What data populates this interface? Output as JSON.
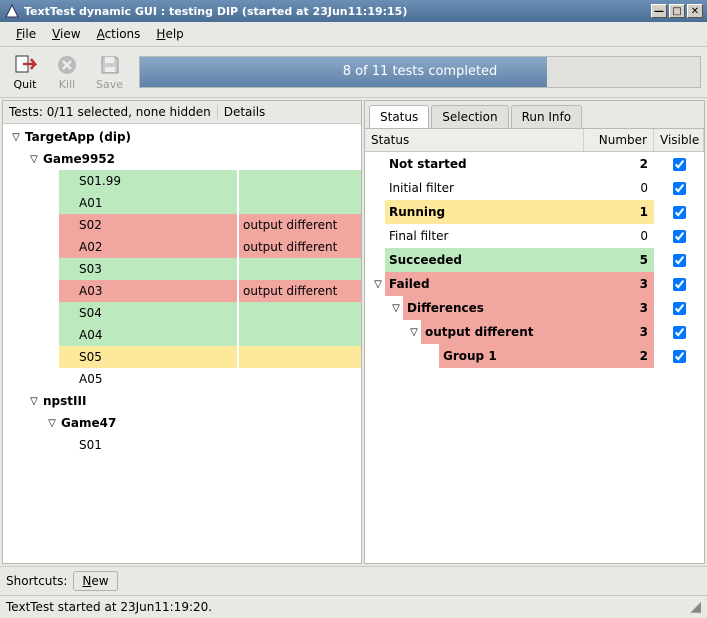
{
  "window": {
    "title": "TextTest dynamic GUI : testing DIP (started at 23Jun11:19:15)"
  },
  "menubar": {
    "file": "File",
    "view": "View",
    "actions": "Actions",
    "help": "Help"
  },
  "toolbar": {
    "quit": "Quit",
    "kill": "Kill",
    "save": "Save"
  },
  "progress": {
    "text": "8 of 11 tests completed"
  },
  "left": {
    "summary": "Tests: 0/11 selected, none hidden",
    "details": "Details",
    "root": "TargetApp (dip)",
    "suite1": "Game9952",
    "tests": [
      {
        "name": "S01.99",
        "detail": "",
        "color": "green"
      },
      {
        "name": "A01",
        "detail": "",
        "color": "green"
      },
      {
        "name": "S02",
        "detail": "output different",
        "color": "red"
      },
      {
        "name": "A02",
        "detail": "output different",
        "color": "red"
      },
      {
        "name": "S03",
        "detail": "",
        "color": "green"
      },
      {
        "name": "A03",
        "detail": "output different",
        "color": "red"
      },
      {
        "name": "S04",
        "detail": "",
        "color": "green"
      },
      {
        "name": "A04",
        "detail": "",
        "color": "green"
      },
      {
        "name": "S05",
        "detail": "",
        "color": "yellow"
      },
      {
        "name": "A05",
        "detail": "",
        "color": "none"
      }
    ],
    "suite2": "npstIII",
    "suite2_game": "Game47",
    "suite2_test": "S01"
  },
  "tabs": {
    "status": "Status",
    "selection": "Selection",
    "runinfo": "Run Info"
  },
  "status_header": {
    "status": "Status",
    "number": "Number",
    "visible": "Visible"
  },
  "status_rows": [
    {
      "indent": 0,
      "exp": "",
      "label": "Not started",
      "num": "2",
      "bold": true,
      "color": "none"
    },
    {
      "indent": 0,
      "exp": "",
      "label": "Initial filter",
      "num": "0",
      "bold": false,
      "color": "none"
    },
    {
      "indent": 0,
      "exp": "",
      "label": "Running",
      "num": "1",
      "bold": true,
      "color": "yellow"
    },
    {
      "indent": 0,
      "exp": "",
      "label": "Final filter",
      "num": "0",
      "bold": false,
      "color": "none"
    },
    {
      "indent": 0,
      "exp": "",
      "label": "Succeeded",
      "num": "5",
      "bold": true,
      "color": "green"
    },
    {
      "indent": 0,
      "exp": "▽",
      "label": "Failed",
      "num": "3",
      "bold": true,
      "color": "red"
    },
    {
      "indent": 1,
      "exp": "▽",
      "label": "Differences",
      "num": "3",
      "bold": true,
      "color": "red"
    },
    {
      "indent": 2,
      "exp": "▽",
      "label": "output different",
      "num": "3",
      "bold": true,
      "color": "red"
    },
    {
      "indent": 3,
      "exp": "",
      "label": "Group 1",
      "num": "2",
      "bold": true,
      "color": "red"
    }
  ],
  "shortcuts": {
    "label": "Shortcuts:",
    "new": "New"
  },
  "statusbar": {
    "text": "TextTest started at 23Jun11:19:20."
  }
}
